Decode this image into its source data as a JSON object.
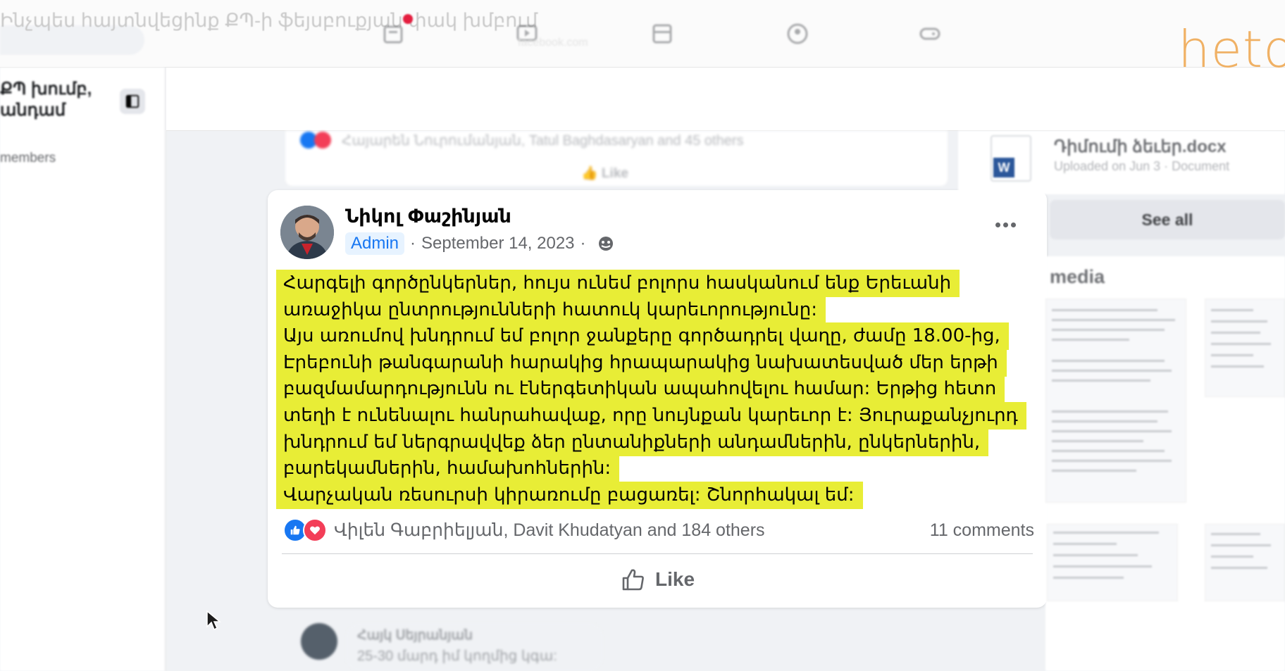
{
  "top_bar": {
    "video_title": "Ինչպես հայտնվեցինք ՔՊ-ի ֆեյսբուքյան փակ խմբում",
    "url_ghost": "facebook.com",
    "brand_logo_text": "heto"
  },
  "sidebar": {
    "group_name": "ՔՊ խումբ,\nանդամ",
    "members_label": "members"
  },
  "previous_post": {
    "reactions_text": "Հայարեն Նուրումանյան, Tatul Baghdasaryan and 45 others",
    "like_label": "Like"
  },
  "post": {
    "author": "Նիկոլ Փաշինյան",
    "role_badge": "Admin",
    "date": "September 14, 2023",
    "body_lines": [
      "Հարգելի գործընկերներ, հույս ունեմ բոլորս հասկանում ենք Երեւանի",
      "առաջիկա ընտրությունների հատուկ կարեւորությունը:",
      "Այս առումով խնդրում եմ բոլոր ջանքերը գործադրել վաղը, ժամը 18.00-ից,",
      "Էրեբունի թանգարանի հարակից հրապարակից  նախատեսված մեր երթի",
      "բազմամարդությունն ու էներգետիկան ապահովելու համար: Երթից հետո",
      "տեղի է ունենալու հանրահավաք, որը նույնքան կարեւոր է: Յուրաքանչյուրդ",
      "խնդրում եմ ներգրավվեք ձեր ընտանիքների անդամներին, ընկերներին,",
      "բարեկամներին, համախոհներին:",
      "Վարչական ռեսուրսի կիրառումը բացառել: Շնորհակալ եմ:"
    ],
    "reactions_text": "Վիլեն Գաբրիելյան, Davit Khudatyan and 184 others",
    "comments_count": "11 comments",
    "like_label": "Like",
    "highlight_color": "#e8ed36"
  },
  "comment_preview": {
    "author": "Հայկ Սեյրանյան",
    "text": "25-30 մարդ իմ կողմից կգա:"
  },
  "right_column": {
    "file_name": "Դիմումի ձեւեր.docx",
    "file_meta": "Uploaded on Jun 3 · Document",
    "file_badge": "W",
    "see_all_label": "See all",
    "media_title": "media"
  },
  "icons": [
    "home-icon",
    "watch-icon",
    "marketplace-icon",
    "groups-icon",
    "gaming-icon",
    "menu-toggle-icon",
    "globe-icon",
    "more-icon",
    "like-icon",
    "love-icon",
    "thumbs-up-icon",
    "word-doc-icon",
    "cursor-icon"
  ]
}
